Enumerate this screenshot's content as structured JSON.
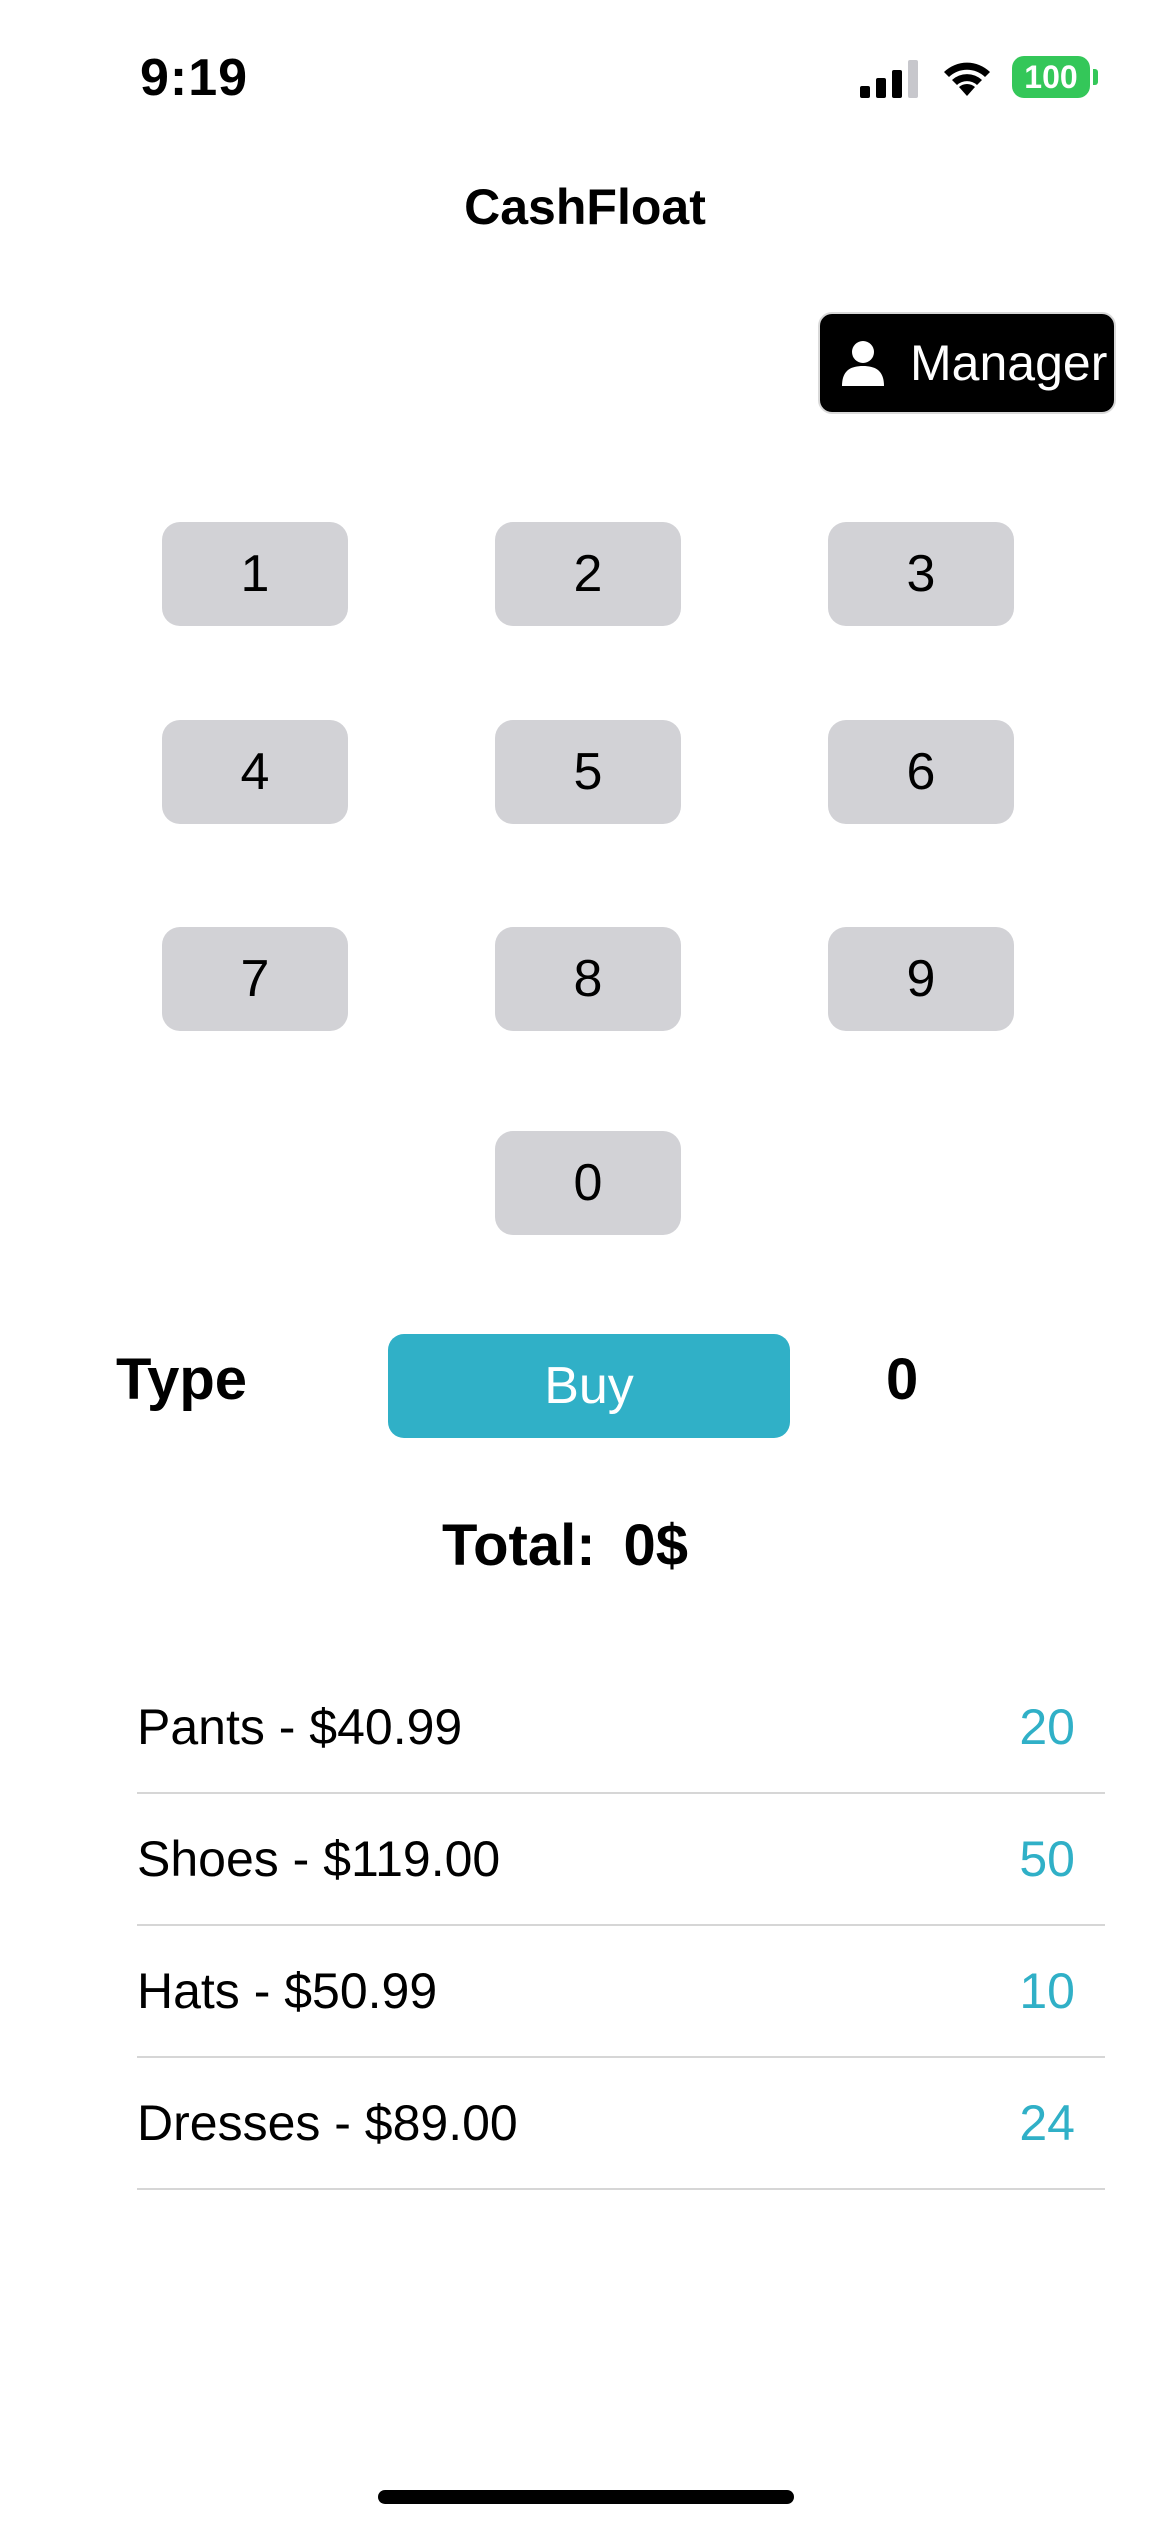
{
  "status_bar": {
    "time": "9:19",
    "battery": "100"
  },
  "nav": {
    "title": "CashFloat"
  },
  "manager_button": {
    "label": "Manager",
    "icon": "person-icon"
  },
  "keypad": {
    "keys": [
      "1",
      "2",
      "3",
      "4",
      "5",
      "6",
      "7",
      "8",
      "9",
      "0"
    ]
  },
  "type_row": {
    "label": "Type",
    "button_label": "Buy",
    "quantity": "0"
  },
  "total": {
    "label": "Total:",
    "value": "0$"
  },
  "products": [
    {
      "name": "Pants - $40.99",
      "quantity": "20"
    },
    {
      "name": "Shoes - $119.00",
      "quantity": "50"
    },
    {
      "name": "Hats - $50.99",
      "quantity": "10"
    },
    {
      "name": "Dresses - $89.00",
      "quantity": "24"
    }
  ],
  "colors": {
    "accent": "#30b0c7",
    "key_background": "#d2d2d6",
    "battery": "#34c759",
    "manager_background": "#000000"
  }
}
